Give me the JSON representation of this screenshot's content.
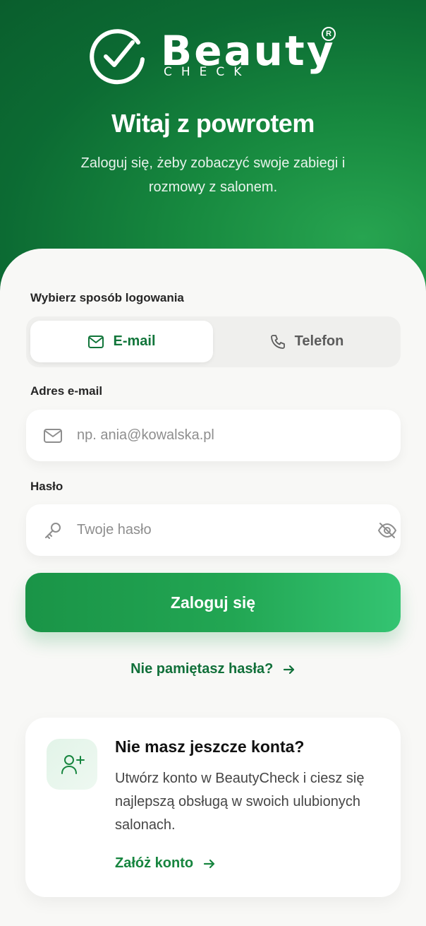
{
  "brand": {
    "name": "Beauty",
    "sub": "CHECK",
    "reg": "R",
    "accent": "#17893f"
  },
  "hero": {
    "title": "Witaj z powrotem",
    "subtitle": "Zaloguj się, żeby zobaczyć swoje zabiegi i rozmowy z salonem."
  },
  "login": {
    "method_label": "Wybierz sposób logowania",
    "methods": [
      {
        "label": "E-mail",
        "icon": "mail-icon",
        "active": true
      },
      {
        "label": "Telefon",
        "icon": "phone-icon",
        "active": false
      }
    ],
    "email": {
      "label": "Adres e-mail",
      "placeholder": "np. ania@kowalska.pl",
      "value": ""
    },
    "password": {
      "label": "Hasło",
      "placeholder": "Twoje hasło",
      "value": ""
    },
    "submit_label": "Zaloguj się",
    "forgot_label": "Nie pamiętasz hasła?"
  },
  "signup": {
    "title": "Nie masz jeszcze konta?",
    "text": "Utwórz konto w BeautyCheck i ciesz się najlepszą obsługą w swoich ulubionych salonach.",
    "link_label": "Załóż konto",
    "icon": "user-plus-icon"
  }
}
